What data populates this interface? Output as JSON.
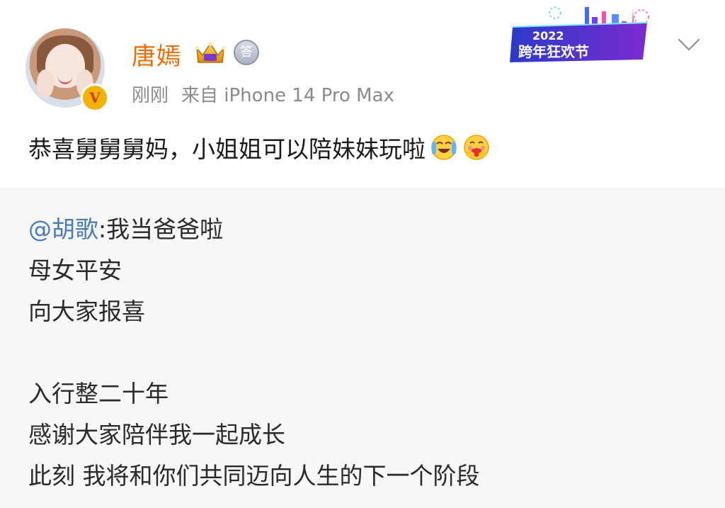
{
  "user": {
    "name": "唐嫣",
    "avatar_badge": "V",
    "answer_badge": "答",
    "time": "刚刚",
    "source": "来自 iPhone 14 Pro Max"
  },
  "event_banner": {
    "year": "2022",
    "title": "跨年狂欢节"
  },
  "post": {
    "text": "恭喜舅舅舅妈，小姐姐可以陪妹妹玩啦"
  },
  "repost": {
    "mention": "@胡歌",
    "first_line_rest": ":我当爸爸啦",
    "lines": [
      "母女平安",
      "向大家报喜",
      "入行整二十年",
      "感谢大家陪伴我一起成长",
      "此刻 我将和你们共同迈向人生的下一个阶段"
    ]
  },
  "colors": {
    "username": "#f26a00",
    "mention": "#4a7bb7",
    "meta": "#8a8a8a",
    "repost_bg": "#f7f7f7"
  },
  "icons": [
    "v-badge-icon",
    "crown-badge-icon",
    "answer-badge-icon",
    "chevron-down-icon",
    "crying-laugh-emoji",
    "hug-emoji"
  ]
}
